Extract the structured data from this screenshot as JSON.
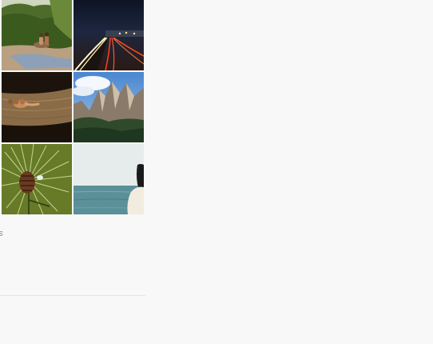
{
  "gallery": {
    "items": [
      {
        "alt": "couple-on-rocks-by-river"
      },
      {
        "alt": "highway-light-trails-night"
      },
      {
        "alt": "sleeping-snail-on-wood"
      },
      {
        "alt": "rocky-mountain-peaks"
      },
      {
        "alt": "pine-cone-on-branch"
      },
      {
        "alt": "woman-looking-at-sea"
      }
    ],
    "caption": "es"
  }
}
